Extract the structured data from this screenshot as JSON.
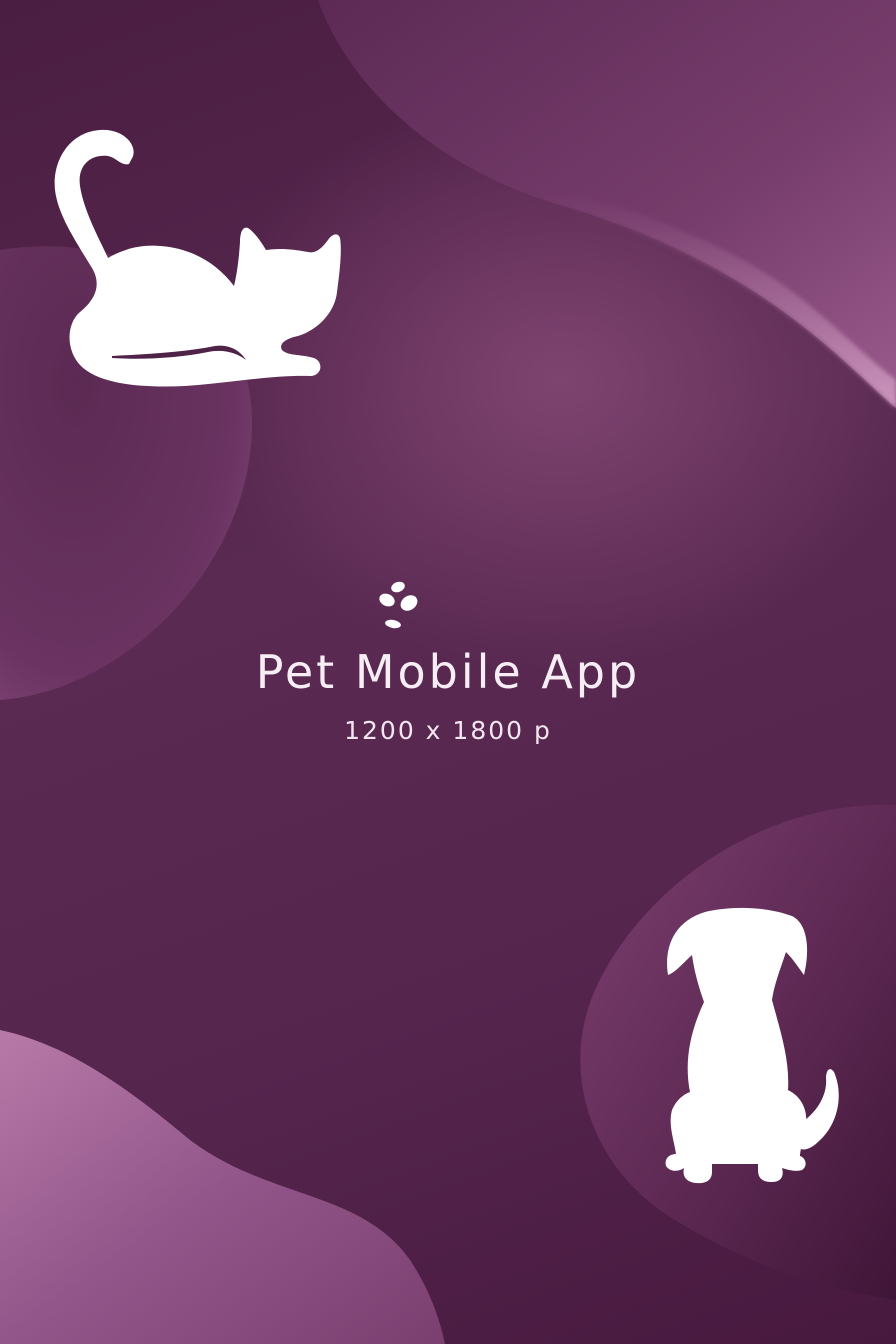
{
  "title": "Pet Mobile App",
  "subtitle": "1200 x 1800 p",
  "colors": {
    "background": "#55254e",
    "blob_light": "#8a4c7c",
    "blob_highlight": "#c08ab3",
    "silhouette": "#ffffff",
    "text": "#f7eef5"
  },
  "icons": [
    "paw-print-icon",
    "cat-silhouette-icon",
    "dog-silhouette-icon"
  ]
}
